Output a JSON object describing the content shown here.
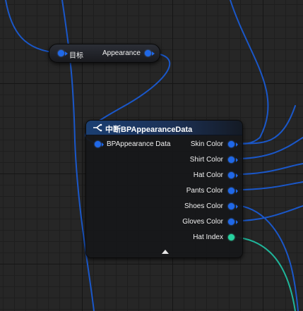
{
  "getter_node": {
    "input_label": "目标",
    "output_label": "Appearance"
  },
  "break_node": {
    "title": "中断BPAppearanceData",
    "icon": "break-struct-icon",
    "input_pin": "BPAppearance Data",
    "output_pins": [
      {
        "label": "Skin Color",
        "type": "struct"
      },
      {
        "label": "Shirt Color",
        "type": "struct"
      },
      {
        "label": "Hat Color",
        "type": "struct"
      },
      {
        "label": "Pants Color",
        "type": "struct"
      },
      {
        "label": "Shoes Color",
        "type": "struct"
      },
      {
        "label": "Gloves Color",
        "type": "struct"
      },
      {
        "label": "Hat Index",
        "type": "integer"
      }
    ],
    "collapse_icon": "collapse-arrow-icon"
  },
  "colors": {
    "struct_pin": "#1f68e8",
    "integer_pin": "#26d3a0",
    "struct_wire": "#1a57c9",
    "integer_wire": "#1fb59a",
    "node_header": "#1b3f72",
    "grid_bg": "#262626"
  }
}
